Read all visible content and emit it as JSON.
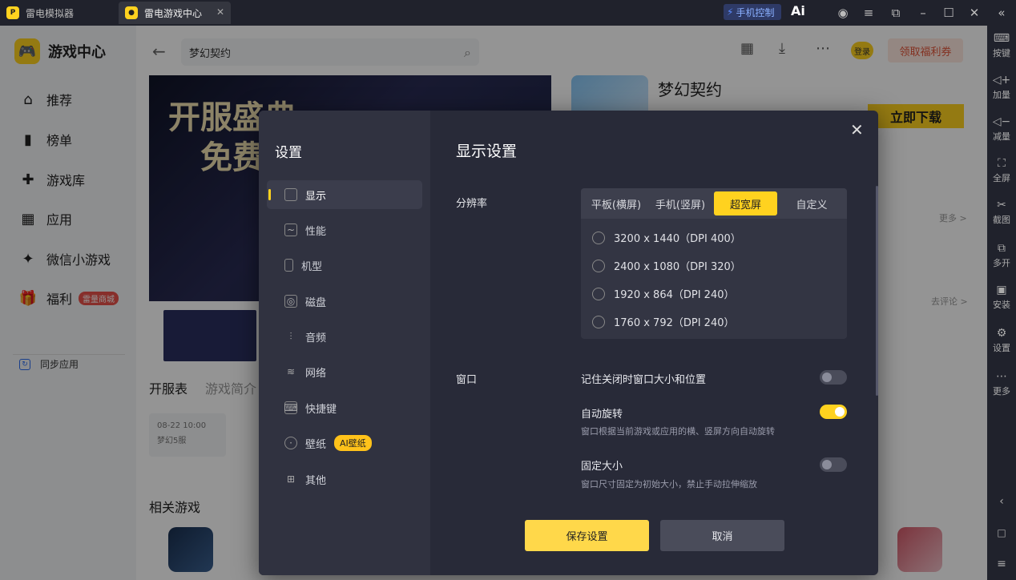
{
  "titlebar": {
    "tab1_label": "雷电模拟器",
    "tab2_label": "雷电游戏中心",
    "phone_control": "手机控制",
    "ai_label": "Ai"
  },
  "leftnav": {
    "brand": "游戏中心",
    "items": [
      {
        "label": "推荐"
      },
      {
        "label": "榜单"
      },
      {
        "label": "游戏库"
      },
      {
        "label": "应用"
      },
      {
        "label": "微信小游戏"
      },
      {
        "label": "福利",
        "badge": "雷量商城"
      }
    ],
    "sync_label": "同步应用"
  },
  "header": {
    "search_value": "梦幻契约",
    "login": "登录",
    "welfare": "领取福利券"
  },
  "game": {
    "title": "梦幻契约",
    "download": "立即下载",
    "banner_line1": "开服盛典",
    "banner_line2": "免费"
  },
  "content": {
    "tab_server": "开服表",
    "tab_intro": "游戏简介",
    "server_time": "08-22 10:00",
    "server_name": "梦幻5服",
    "related": "相关游戏",
    "more": "更多 >",
    "comment": "去评论 >"
  },
  "rightbar": [
    {
      "label": "按键",
      "icon": "keyboard-icon"
    },
    {
      "label": "加量",
      "icon": "volume-up-icon"
    },
    {
      "label": "减量",
      "icon": "volume-down-icon"
    },
    {
      "label": "全屏",
      "icon": "fullscreen-icon"
    },
    {
      "label": "截图",
      "icon": "scissors-icon"
    },
    {
      "label": "多开",
      "icon": "multi-window-icon"
    },
    {
      "label": "安装",
      "icon": "install-icon"
    },
    {
      "label": "设置",
      "icon": "gear-icon"
    },
    {
      "label": "更多",
      "icon": "more-icon"
    }
  ],
  "settings": {
    "title": "设置",
    "menu": [
      {
        "label": "显示"
      },
      {
        "label": "性能"
      },
      {
        "label": "机型"
      },
      {
        "label": "磁盘"
      },
      {
        "label": "音频"
      },
      {
        "label": "网络"
      },
      {
        "label": "快捷键"
      },
      {
        "label": "壁纸",
        "badge": "AI壁纸"
      },
      {
        "label": "其他"
      }
    ],
    "section_title": "显示设置",
    "resolution_label": "分辨率",
    "segments": [
      {
        "label": "平板(横屏)"
      },
      {
        "label": "手机(竖屏)"
      },
      {
        "label": "超宽屏"
      },
      {
        "label": "自定义"
      }
    ],
    "active_segment": "超宽屏",
    "resolutions": [
      {
        "label": "3200 x 1440（DPI 400）"
      },
      {
        "label": "2400 x 1080（DPI 320）"
      },
      {
        "label": "1920 x 864（DPI 240）"
      },
      {
        "label": "1760 x 792（DPI 240）"
      }
    ],
    "window_label": "窗口",
    "options": [
      {
        "title": "记住关闭时窗口大小和位置",
        "desc": "",
        "on": false
      },
      {
        "title": "自动旋转",
        "desc": "窗口根据当前游戏或应用的横、竖屏方向自动旋转",
        "on": true
      },
      {
        "title": "固定大小",
        "desc": "窗口尺寸固定为初始大小，禁止手动拉伸缩放",
        "on": false
      }
    ],
    "save": "保存设置",
    "cancel": "取消"
  },
  "colors": {
    "accent": "#ffd21f",
    "modal_bg": "#282a38",
    "sidebar_bg": "#303240"
  }
}
